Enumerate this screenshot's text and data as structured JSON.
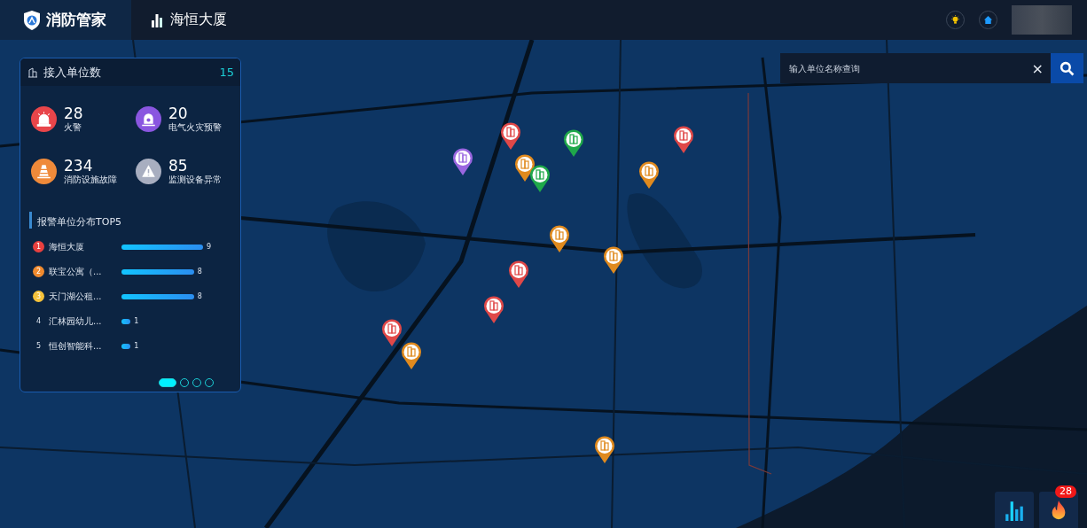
{
  "header": {
    "app_title": "消防管家",
    "building": "海恒大厦"
  },
  "search": {
    "placeholder": "输入单位名称查询",
    "clear": "×"
  },
  "panel": {
    "title": "接入单位数",
    "count": "15",
    "stats": [
      {
        "value": "28",
        "label": "火警",
        "kind": "alarm",
        "color": "#e8454a"
      },
      {
        "value": "20",
        "label": "电气火灾预警",
        "kind": "electric",
        "color": "#8a56e0"
      },
      {
        "value": "234",
        "label": "消防设施故障",
        "kind": "cone",
        "color": "#ef8a3a"
      },
      {
        "value": "85",
        "label": "监测设备异常",
        "kind": "warning",
        "color": "#a8aec0"
      }
    ],
    "top5_title": "报警单位分布TOP5",
    "top5": [
      {
        "rank": "1",
        "name": "海恒大厦",
        "value": "9",
        "color": "#e8403f"
      },
      {
        "rank": "2",
        "name": "联宝公寓（...",
        "value": "8",
        "color": "#f08a2e"
      },
      {
        "rank": "3",
        "name": "天门湖公租...",
        "value": "8",
        "color": "#f5c23a"
      },
      {
        "rank": "4",
        "name": "汇林园幼儿...",
        "value": "1"
      },
      {
        "rank": "5",
        "name": "恒创智能科...",
        "value": "1"
      }
    ],
    "pages": [
      {
        "selected": true
      },
      {
        "selected": false
      },
      {
        "selected": false
      },
      {
        "selected": false
      }
    ]
  },
  "markers": [
    {
      "color": "#e04848"
    },
    {
      "color": "#1fa84a"
    },
    {
      "color": "#e08a1e"
    },
    {
      "color": "#1fa84a"
    },
    {
      "color": "#9a66e0"
    },
    {
      "color": "#e04848"
    },
    {
      "color": "#e08a1e"
    },
    {
      "color": "#e08a1e"
    },
    {
      "color": "#e08a1e"
    },
    {
      "color": "#e04848"
    },
    {
      "color": "#e04848"
    },
    {
      "color": "#e04848"
    },
    {
      "color": "#e08a1e"
    },
    {
      "color": "#e08a1e"
    }
  ],
  "fire_badge": "28"
}
